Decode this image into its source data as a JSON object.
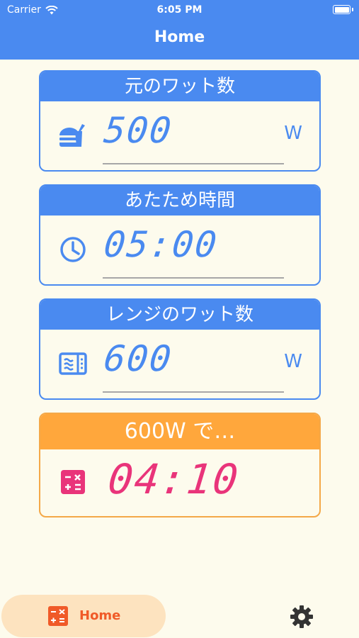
{
  "status": {
    "carrier": "Carrier",
    "time": "6:05 PM"
  },
  "appbar": {
    "title": "Home"
  },
  "cards": {
    "original_watt": {
      "header": "元のワット数",
      "value": "500",
      "unit": "W",
      "icon": "food-icon"
    },
    "heat_time": {
      "header": "あたため時間",
      "value": "05:00",
      "icon": "clock-icon"
    },
    "range_watt": {
      "header": "レンジのワット数",
      "value": "600",
      "unit": "W",
      "icon": "microwave-icon"
    },
    "result": {
      "header": "600W で…",
      "value": "04:10",
      "icon": "calculator-icon"
    }
  },
  "bottom_nav": {
    "home_label": "Home",
    "settings_icon": "gear-icon"
  },
  "colors": {
    "primary": "#4a8af0",
    "accent": "#ffa73c",
    "result": "#e9347a",
    "background": "#fdfbed"
  }
}
